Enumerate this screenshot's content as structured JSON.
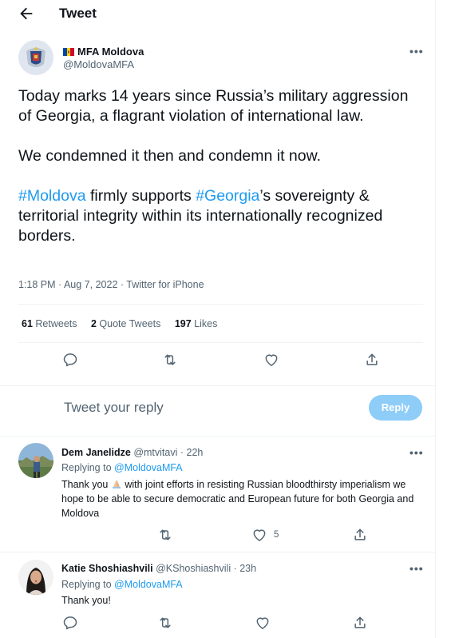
{
  "header": {
    "title": "Tweet"
  },
  "tweet": {
    "author_name": "MFA Moldova",
    "author_handle": "@MoldovaMFA",
    "text_line1": "Today marks 14 years since Russia’s military aggression of Georgia, a flagrant violation of international law.",
    "text_line2": "We condemned it then and condemn it now.",
    "hashtag1": "#Moldova",
    "text_line3a": " firmly supports ",
    "hashtag2": "#Georgia",
    "text_line3b": "’s sovereignty & territorial integrity within its internationally recognized borders.",
    "meta": "1:18 PM · Aug 7, 2022 · Twitter for iPhone",
    "stats": {
      "retweets_count": "61",
      "retweets_label": "Retweets",
      "quotes_count": "2",
      "quotes_label": "Quote Tweets",
      "likes_count": "197",
      "likes_label": "Likes"
    }
  },
  "compose": {
    "placeholder": "Tweet your reply",
    "button": "Reply"
  },
  "replies": [
    {
      "name": "Dem Janelidze",
      "handle": "@mtvitavi",
      "time": "· 22h",
      "replying_prefix": "Replying to ",
      "replying_to": "@MoldovaMFA",
      "text_a": "Thank you ",
      "text_b": " with joint efforts in resisting Russian bloodthirsty imperialism we hope to be able to secure democratic and European future for both Georgia and Moldova",
      "likes": "5"
    },
    {
      "name": "Katie Shoshiashvili",
      "handle": "@KShoshiashvili",
      "time": "· 23h",
      "replying_prefix": "Replying to ",
      "replying_to": "@MoldovaMFA",
      "text_a": "Thank you!"
    }
  ],
  "colors": {
    "accent": "#1d9bf0",
    "reply_button": "#8ecdf8",
    "secondary_text": "#536471"
  }
}
